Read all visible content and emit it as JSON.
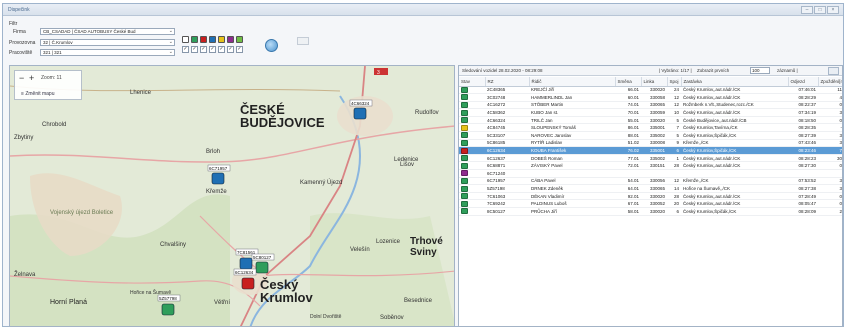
{
  "window": {
    "title": "Dispečink",
    "controls": [
      "–",
      "□",
      "×"
    ]
  },
  "filter": {
    "heading": "Filtr",
    "firm_label": "Firma",
    "firm_value": "CB_CSADAD | ČSAD AUTOBUSY České Bud",
    "provoz_label": "Provozovna",
    "provoz_value": "32 | Č.Krumlov",
    "pracoviste_label": "Pracoviště",
    "pracoviste_value": "321 | 321",
    "status_colors": [
      "#ffffff",
      "#2f9e5b",
      "#c81f1f",
      "#1f6fb4",
      "#e6c21a",
      "#8e2b8e",
      "#6fbd44"
    ]
  },
  "map": {
    "zoom_label": "Zoom: 11",
    "change_map_label": "Změnit mapu",
    "places": [
      {
        "name": "ČESKÉ",
        "big": true
      },
      {
        "name": "BUDĚJOVICE",
        "big": true
      },
      {
        "name": "Český",
        "big": true
      },
      {
        "name": "Krumlov",
        "big": true
      },
      {
        "name": "Trhové",
        "big": true
      },
      {
        "name": "Sviny",
        "big": true
      },
      {
        "name": "Rudolfov"
      },
      {
        "name": "Lišov"
      },
      {
        "name": "Chrobold"
      },
      {
        "name": "Zbytiny"
      },
      {
        "name": "Křemže"
      },
      {
        "name": "Kamenný Újezd"
      },
      {
        "name": "Ledenice"
      },
      {
        "name": "Chvalšiny"
      },
      {
        "name": "Velešín"
      },
      {
        "name": "Lozenice"
      },
      {
        "name": "Vojenský újezd Boletice"
      },
      {
        "name": "Želnava"
      },
      {
        "name": "Horní Planá"
      },
      {
        "name": "Větřní"
      },
      {
        "name": "Besednice"
      },
      {
        "name": "Soběnov"
      },
      {
        "name": "Brloh"
      },
      {
        "name": "Lhenice"
      },
      {
        "name": "Hořice na Šumavě"
      },
      {
        "name": "Dolní Dvořiště"
      }
    ],
    "buses": [
      {
        "id": "4C66324",
        "color": "#1f6fb4"
      },
      {
        "id": "6C71957",
        "color": "#1f6fb4"
      },
      {
        "id": "7C81561",
        "color": "#1f6fb4"
      },
      {
        "id": "5C80127",
        "color": "#2f9e5b"
      },
      {
        "id": "6C12634",
        "color": "#c81f1f"
      },
      {
        "id": "5Z57798",
        "color": "#2f9e5b"
      }
    ]
  },
  "table": {
    "since_label": "Sledování vozidel 28.02.2020 - 08:29:08",
    "selected_label": "| Vybráno: 1/17 |",
    "show_first_label": "Zobrazit prvních",
    "show_first_value": "100",
    "records_label": "záznamů |",
    "columns": [
      "Stav",
      "RZ",
      "Řidič",
      "Směna",
      "Linka",
      "Spoj",
      "Zastávka",
      "Odjezd",
      "Zpoždění[min]"
    ],
    "rows": [
      {
        "color": "#2f9e5b",
        "rz": "2C48365",
        "driver": "KREJČÍ Jiří",
        "smena": "66.01",
        "linka": "330020",
        "spoj": "24",
        "stop": "Český Krumlov,,aut.nádr./CK",
        "odjezd": "07:46:01",
        "delay": "11"
      },
      {
        "color": "#2f9e5b",
        "rz": "3C02748",
        "driver": "HAMMERLINDL Jan",
        "smena": "60.01",
        "linka": "330058",
        "spoj": "12",
        "stop": "Český Krumlov,,aut.nádr./CK",
        "odjezd": "08:28:29",
        "delay": "4"
      },
      {
        "color": "#2f9e5b",
        "rz": "4C16272",
        "driver": "STÖBER Martin",
        "smena": "74.01",
        "linka": "330065",
        "spoj": "12",
        "stop": "Rožmberk n.Vlt.,Studenec,rozc./CK",
        "odjezd": "08:22:37",
        "delay": "0"
      },
      {
        "color": "#2f9e5b",
        "rz": "4C58362",
        "driver": "KUBO Jan st.",
        "smena": "70.01",
        "linka": "330059",
        "spoj": "10",
        "stop": "Český Krumlov,,aut.nádr./CK",
        "odjezd": "07:34:19",
        "delay": "3"
      },
      {
        "color": "#2f9e5b",
        "rz": "4C66324",
        "driver": "TRILČ Jan",
        "smena": "55.01",
        "linka": "330020",
        "spoj": "5",
        "stop": "České Budějovice,,aut.nádr./CB",
        "odjezd": "08:18:50",
        "delay": "0"
      },
      {
        "color": "#e6c21a",
        "rz": "4C84745",
        "driver": "SLOUPENSKÝ Tomáš",
        "smena": "86.01",
        "linka": "335001",
        "spoj": "7",
        "stop": "Český Krumlov,Tavírna,/CK",
        "odjezd": "08:28:35",
        "delay": "-"
      },
      {
        "color": "#2f9e5b",
        "rz": "5C33107",
        "driver": "NAROVEC Jaroslav",
        "smena": "88.01",
        "linka": "335002",
        "spoj": "5",
        "stop": "Český Krumlov,Špičák,/CK",
        "odjezd": "08:27:39",
        "delay": "3"
      },
      {
        "color": "#2f9e5b",
        "rz": "5C86185",
        "driver": "RYTÍŘ Ladislav",
        "smena": "51.02",
        "linka": "330008",
        "spoj": "9",
        "stop": "Křemže,,/CK",
        "odjezd": "07:43:46",
        "delay": "3"
      },
      {
        "color": "#c81f1f",
        "rz": "6C12634",
        "driver": "KOUBA František",
        "smena": "76.02",
        "linka": "335001",
        "spoj": "6",
        "stop": "Český Krumlov,Špičák,/CK",
        "odjezd": "08:23:46",
        "delay": "7",
        "selected": true
      },
      {
        "color": "#2f9e5b",
        "rz": "6C12637",
        "driver": "DOBEŠ Roman",
        "smena": "77.01",
        "linka": "335002",
        "spoj": "1",
        "stop": "Český Krumlov,,aut.nádr./CK",
        "odjezd": "08:28:23",
        "delay": "30"
      },
      {
        "color": "#2f9e5b",
        "rz": "6C68871",
        "driver": "ZÁVISKÝ Pavel",
        "smena": "72.01",
        "linka": "330151",
        "spoj": "28",
        "stop": "Český Krumlov,,aut.nádr./CK",
        "odjezd": "08:27:30",
        "delay": "0"
      },
      {
        "color": "#8e2b8e",
        "rz": "6C71240",
        "driver": "",
        "smena": "",
        "linka": "",
        "spoj": "",
        "stop": "",
        "odjezd": "",
        "delay": ""
      },
      {
        "color": "#2f9e5b",
        "rz": "6C71957",
        "driver": "CÁBA Pavel",
        "smena": "54.01",
        "linka": "330056",
        "spoj": "12",
        "stop": "Křemže,,/CK",
        "odjezd": "07:53:52",
        "delay": "3"
      },
      {
        "color": "#2f9e5b",
        "rz": "5Z57198",
        "driver": "DRNEK Zdeněk",
        "smena": "64.01",
        "linka": "330065",
        "spoj": "14",
        "stop": "Hořice na Šumavě,,/CK",
        "odjezd": "08:27:38",
        "delay": "3"
      },
      {
        "color": "#2f9e5b",
        "rz": "7C61063",
        "driver": "DĚKAN Vladimír",
        "smena": "92.01",
        "linka": "330020",
        "spoj": "28",
        "stop": "Český Krumlov,,aut.nádr./CK",
        "odjezd": "07:28:49",
        "delay": "0"
      },
      {
        "color": "#2f9e5b",
        "rz": "7C69242",
        "driver": "PALDINUS Luboš",
        "smena": "67.01",
        "linka": "330052",
        "spoj": "20",
        "stop": "Český Krumlov,,aut.nádr./CK",
        "odjezd": "08:05:47",
        "delay": "0"
      },
      {
        "color": "#2f9e5b",
        "rz": "8C50127",
        "driver": "PRŮCHA Jiří",
        "smena": "58.01",
        "linka": "330020",
        "spoj": "6",
        "stop": "Český Krumlov,Špičák,/CK",
        "odjezd": "08:28:09",
        "delay": "2"
      }
    ]
  }
}
